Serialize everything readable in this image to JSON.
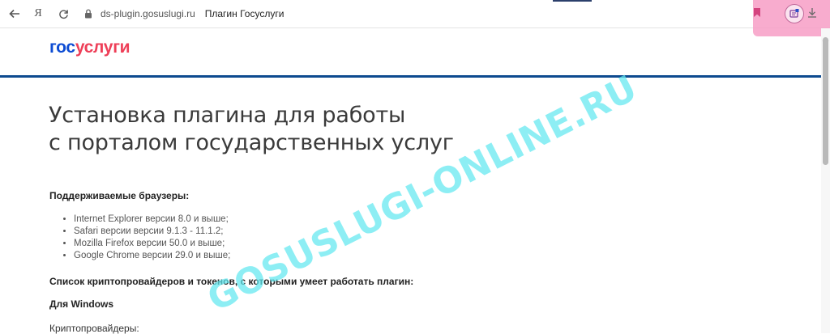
{
  "browser": {
    "back_icon": "arrow-left-icon",
    "yandex_label": "Я",
    "reload_icon": "reload-icon",
    "lock_icon": "lock-icon",
    "domain": "ds-plugin.gosuslugi.ru",
    "tab_title": "Плагин Госуслуги",
    "bookmark_icon": "bookmark-icon",
    "extension_icon": "plugin-extension-icon",
    "download_icon": "download-icon",
    "highlight_color": "#f79ec6"
  },
  "logo": {
    "part1": "гос",
    "part2": "услуги"
  },
  "page": {
    "title_line1": "Установка плагина для работы",
    "title_line2": "с порталом государственных услуг",
    "supported_heading": "Поддерживаемые браузеры:",
    "browsers": [
      "Internet Explorer версии 8.0 и выше;",
      "Safari версии версии 9.1.3 - 11.1.2;",
      "Mozilla Firefox версии 50.0 и выше;",
      "Google Chrome версии 29.0 и выше;"
    ],
    "crypto_heading": "Список криптопровайдеров и токенов, с которыми умеет работать плагин:",
    "windows_heading": "Для Windows",
    "providers_label": "Криптопровайдеры:"
  },
  "watermark": "GOSUSLUGI-ONLINE.RU",
  "colors": {
    "brand_blue": "#0d4cd3",
    "brand_red": "#ee3f58",
    "header_line": "#0d4a8f",
    "watermark": "#62e8f0"
  }
}
